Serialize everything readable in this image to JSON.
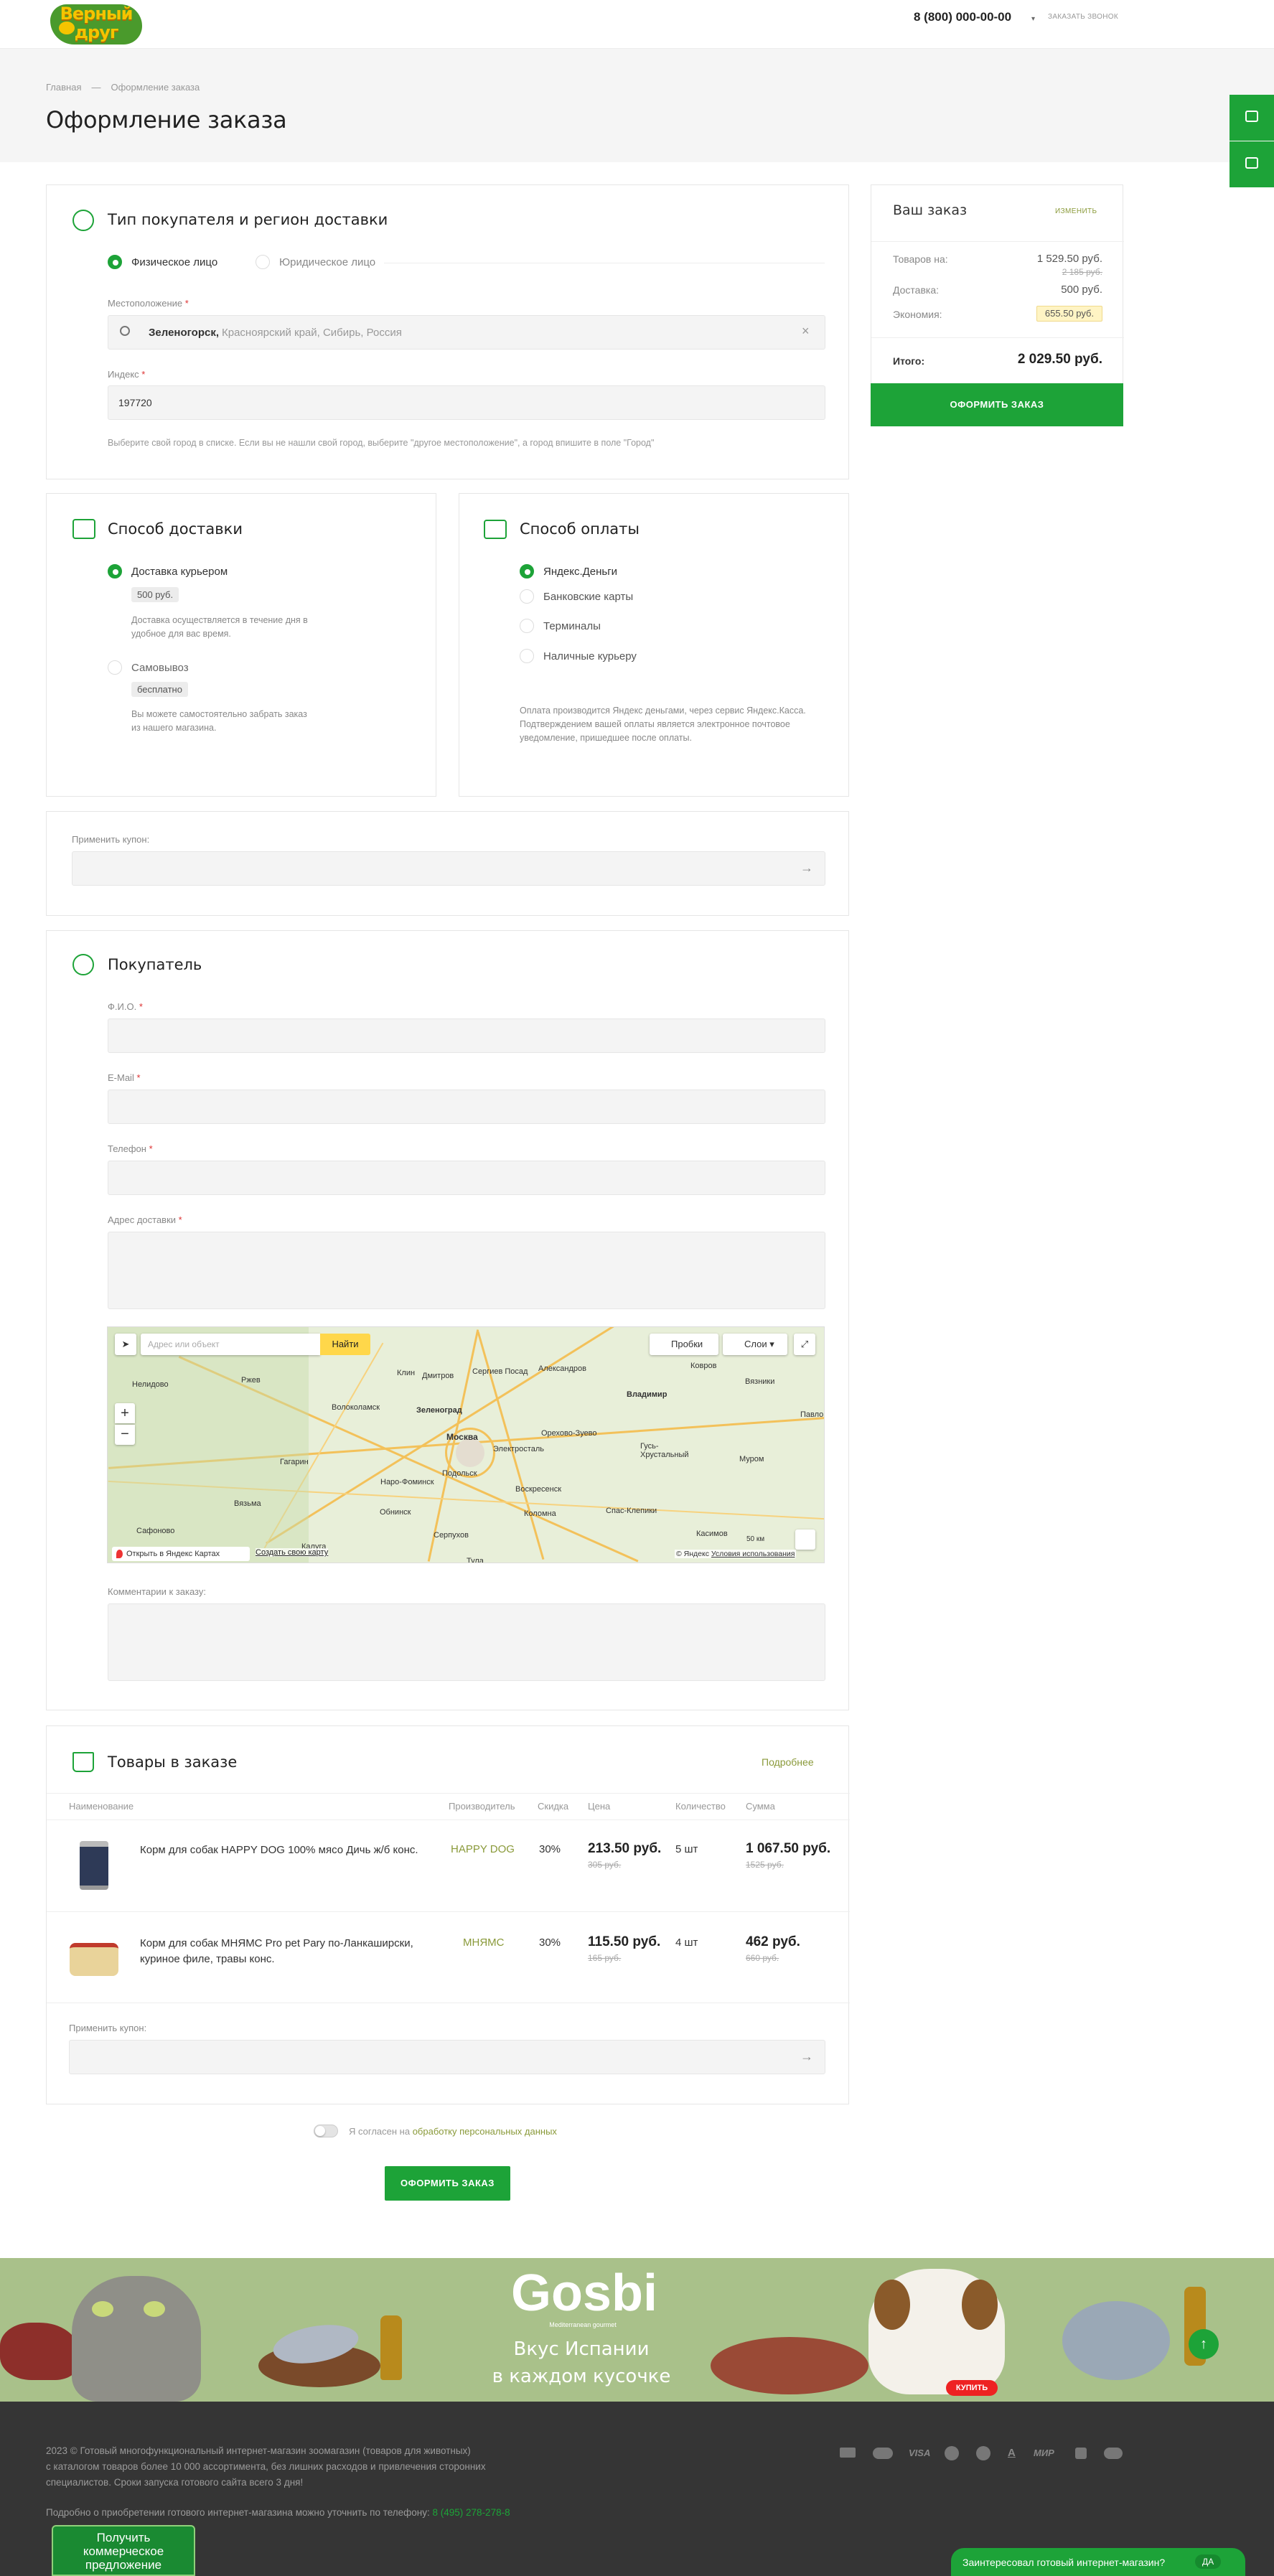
{
  "header": {
    "logo_text": "Верный друг",
    "phone": "8 (800) 000-00-00",
    "callback_label": "ЗАКАЗАТЬ ЗВОНОК"
  },
  "breadcrumbs": [
    "Главная",
    "—",
    "Оформление заказа"
  ],
  "page_title": "Оформление заказа",
  "buyer_type": {
    "title": "Тип покупателя и регион доставки",
    "options": [
      "Физическое лицо",
      "Юридическое лицо"
    ],
    "location_label": "Местоположение",
    "location_city": "Зеленогорск,",
    "location_region": "Красноярский край, Сибирь, Россия",
    "index_label": "Индекс",
    "index_value": "197720",
    "hint": "Выберите свой город в списке. Если вы не нашли свой город, выберите \"другое местоположение\", а город впишите в поле \"Город\""
  },
  "delivery": {
    "title": "Способ доставки",
    "opt1": "Доставка курьером",
    "opt1_price": "500 руб.",
    "opt1_desc": "Доставка осуществляется в течение дня в удобное для вас время.",
    "opt2": "Самовывоз",
    "opt2_price": "бесплатно",
    "opt2_desc": "Вы можете самостоятельно забрать заказ из нашего магазина."
  },
  "payment": {
    "title": "Способ оплаты",
    "options": [
      "Яндекс.Деньги",
      "Банковские карты",
      "Терминалы",
      "Наличные курьеру"
    ],
    "desc": "Оплата производится Яндекс деньгами, через сервис Яндекс.Касса. Подтверждением вашей оплаты является электронное почтовое уведомление, пришедшее после оплаты."
  },
  "coupon": {
    "label": "Применить купон:"
  },
  "customer": {
    "title": "Покупатель",
    "name_label": "Ф.И.О.",
    "email_label": "E-Mail",
    "phone_label": "Телефон",
    "address_label": "Адрес доставки",
    "comment_label": "Комментарии к заказу:"
  },
  "map": {
    "search_placeholder": "Адрес или объект",
    "find_button": "Найти",
    "traffic_button": "Пробки",
    "layers_button": "Слои",
    "open_link": "Открыть в Яндекс Картах",
    "create_link": "Создать свою карту",
    "copyright": "© Яндекс",
    "terms": "Условия использования",
    "scale": "50 км",
    "cities": [
      "Москва",
      "Зеленоград",
      "Владимир",
      "Сергиев Посад",
      "Александров",
      "Ковров",
      "Дмитров",
      "Клин",
      "Ржев",
      "Волоколамск",
      "Электросталь",
      "Орехово-Зуево",
      "Гусь-Хрустальный",
      "Муром",
      "Подольск",
      "Наро-Фоминск",
      "Воскресенск",
      "Коломна",
      "Серпухов",
      "Обнинск",
      "Калуга",
      "Гагарин",
      "Вязьма",
      "Касимов",
      "Спас-Клепики",
      "Тула",
      "Нелидово",
      "Вязники",
      "Павлово",
      "Сафоново"
    ]
  },
  "products": {
    "title": "Товары в заказе",
    "more_link": "Подробнее",
    "columns": [
      "Наименование",
      "Производитель",
      "Скидка",
      "Цена",
      "Количество",
      "Сумма"
    ],
    "rows": [
      {
        "name": "Корм для собак HAPPY DOG 100% мясо Дичь ж/б конс.",
        "brand": "HAPPY DOG",
        "discount": "30%",
        "price": "213.50 руб.",
        "old_price": "305 руб.",
        "qty": "5 шт",
        "sum": "1 067.50 руб.",
        "old_sum": "1525 руб."
      },
      {
        "name": "Корм для собак MHЯMC Pro pet Pary по-Ланкаширски, куриное филе, травы конс.",
        "brand": "MHЯMC",
        "discount": "30%",
        "price": "115.50 руб.",
        "old_price": "165 руб.",
        "qty": "4 шт",
        "sum": "462 руб.",
        "old_sum": "660 руб."
      }
    ]
  },
  "consent": {
    "text": "Я согласен на",
    "link": "обработку персональных данных"
  },
  "submit_label": "ОФОРМИТЬ ЗАКАЗ",
  "summary": {
    "title": "Ваш заказ",
    "change_link": "ИЗМЕНИТЬ",
    "goods_label": "Товаров на:",
    "goods_value": "1 529.50 руб.",
    "goods_old": "2 185 руб.",
    "delivery_label": "Доставка:",
    "delivery_value": "500 руб.",
    "saving_label": "Экономия:",
    "saving_value": "655.50 руб.",
    "total_label": "Итого:",
    "total_value": "2 029.50 руб.",
    "button": "ОФОРМИТЬ ЗАКАЗ"
  },
  "banner": {
    "brand": "Gosbi",
    "brand_sub": "Mediterranean gourmet",
    "line1": "Вкус Испании",
    "line2": "в каждом кусочке",
    "buy": "КУПИТЬ"
  },
  "footer": {
    "text1": "2023 © Готовый многофункциональный интернет-магазин зоомагазин (товаров для животных)",
    "text2": "с каталогом товаров более 10 000 ассортимента, без лишних расходов и привлечения сторонних",
    "text3": "специалистов. Сроки запуска готового сайта всего 3 дня!",
    "text4": "Подробно о приобретении готового интернет-магазина можно уточнить по телефону:",
    "phone": "8 (495) 278-278-8",
    "promo1": "Получить",
    "promo2": "коммерческое",
    "promo3": "предложение",
    "payments": [
      "VISA",
      "A",
      "МИР"
    ],
    "chat_text": "Заинтересовал готовый интернет-магазин?",
    "chat_btn": "ДА"
  }
}
